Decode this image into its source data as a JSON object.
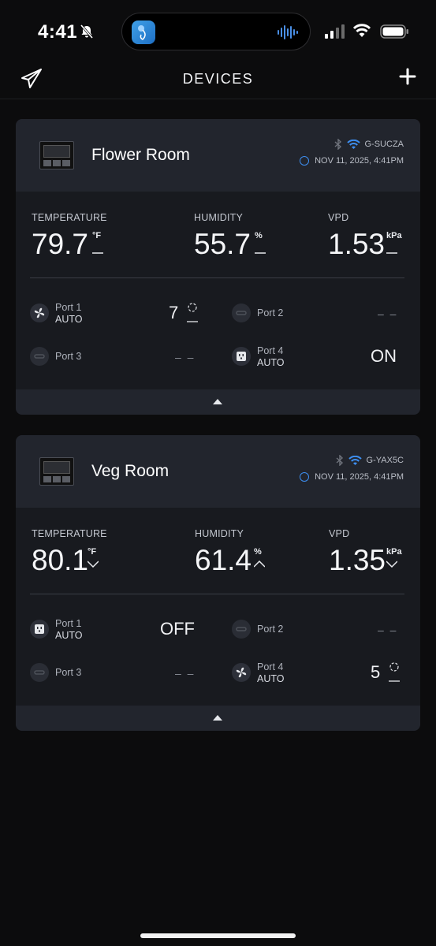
{
  "status_bar": {
    "time": "4:41",
    "icons": [
      "bell-slash-icon",
      "signal-icon",
      "wifi-icon",
      "battery-icon"
    ]
  },
  "header": {
    "title": "DEVICES",
    "logo_icon": "paper-plane-logo",
    "add_icon": "plus-icon"
  },
  "devices": [
    {
      "name": "Flower Room",
      "network": "G-SUCZA",
      "timestamp": "NOV 11, 2025, 4:41PM",
      "temperature": {
        "label": "TEMPERATURE",
        "value": "79.7",
        "unit": "°F",
        "trend": "flat"
      },
      "humidity": {
        "label": "HUMIDITY",
        "value": "55.7",
        "unit": "%",
        "trend": "flat"
      },
      "vpd": {
        "label": "VPD",
        "value": "1.53",
        "unit": "kPa",
        "trend": "flat"
      },
      "ports": [
        {
          "name": "Port 1",
          "mode": "AUTO",
          "icon": "fan-icon",
          "value": "7"
        },
        {
          "name": "Port 2",
          "mode": "",
          "icon": "link-icon",
          "value": "– –"
        },
        {
          "name": "Port 3",
          "mode": "",
          "icon": "link-icon",
          "value": "– –"
        },
        {
          "name": "Port 4",
          "mode": "AUTO",
          "icon": "outlet-icon",
          "value": "ON"
        }
      ]
    },
    {
      "name": "Veg Room",
      "network": "G-YAX5C",
      "timestamp": "NOV 11, 2025, 4:41PM",
      "temperature": {
        "label": "TEMPERATURE",
        "value": "80.1",
        "unit": "°F",
        "trend": "down"
      },
      "humidity": {
        "label": "HUMIDITY",
        "value": "61.4",
        "unit": "%",
        "trend": "up"
      },
      "vpd": {
        "label": "VPD",
        "value": "1.35",
        "unit": "kPa",
        "trend": "down"
      },
      "ports": [
        {
          "name": "Port 1",
          "mode": "AUTO",
          "icon": "outlet-icon",
          "value": "OFF"
        },
        {
          "name": "Port 2",
          "mode": "",
          "icon": "link-icon",
          "value": "– –"
        },
        {
          "name": "Port 3",
          "mode": "",
          "icon": "link-icon",
          "value": "– –"
        },
        {
          "name": "Port 4",
          "mode": "AUTO",
          "icon": "fan-icon",
          "value": "5"
        }
      ]
    }
  ],
  "colors": {
    "accent": "#3d8ef0",
    "card": "#181a1f",
    "card_header": "#22252d",
    "background": "#0c0c0d"
  }
}
